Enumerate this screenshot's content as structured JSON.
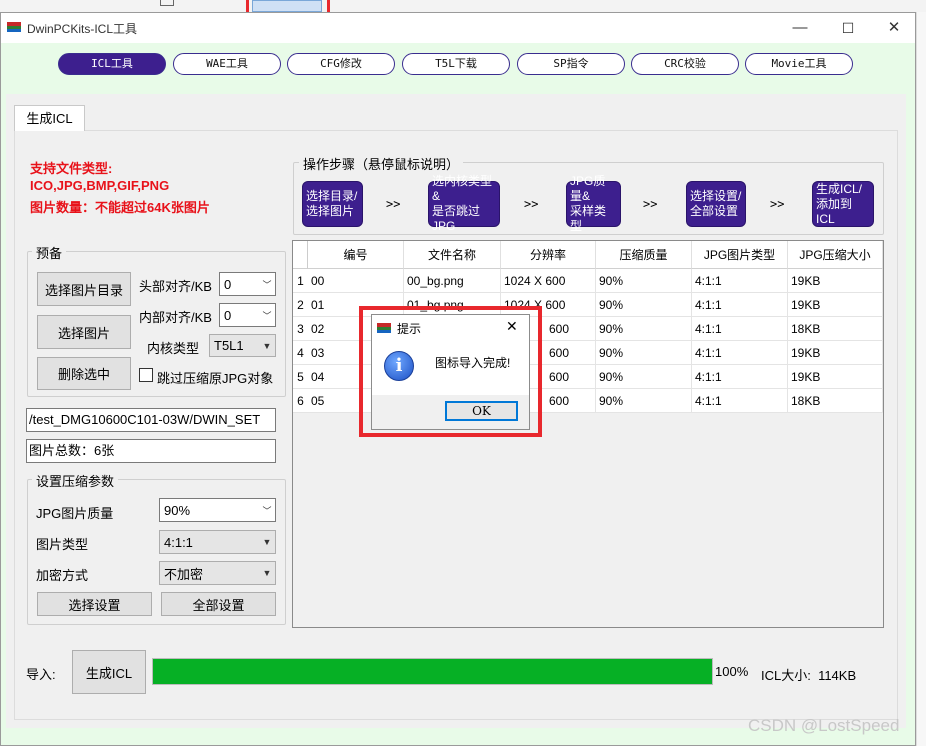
{
  "window": {
    "title": "DwinPCKits-ICL工具",
    "min_glyph": "—",
    "max_glyph": "☐",
    "close_glyph": "✕"
  },
  "top_tabs": [
    "ICL工具",
    "WAE工具",
    "CFG修改",
    "T5L下载",
    "SP指令",
    "CRC校验",
    "Movie工具"
  ],
  "subtab": "生成ICL",
  "supported": {
    "line1": "支持文件类型:",
    "line2": "ICO,JPG,BMP,GIF,PNG",
    "line3": "图片数量：不能超过64K张图片"
  },
  "steps": {
    "title": "操作步骤（悬停鼠标说明）",
    "items": [
      [
        "选择目录/",
        "选择图片"
      ],
      [
        "选内核类型&",
        "是否跳过JPG"
      ],
      [
        "JPG质量&",
        "采样类型"
      ],
      [
        "选择设置/",
        "全部设置"
      ],
      [
        "生成ICL/",
        "添加到ICL"
      ]
    ],
    "sep": ">>"
  },
  "prep": {
    "title": "预备",
    "select_dir": "选择图片目录",
    "select_img": "选择图片",
    "delete_sel": "删除选中",
    "head_align_label": "头部对齐/KB",
    "head_align_value": "0",
    "inner_align_label": "内部对齐/KB",
    "inner_align_value": "0",
    "core_label": "内核类型",
    "core_value": "T5L1",
    "skip_jpg_label": "跳过压缩原JPG对象"
  },
  "path_value": "/test_DMG10600C101-03W/DWIN_SET",
  "total_value": "图片总数：6张",
  "compress": {
    "title": "设置压缩参数",
    "quality_label": "JPG图片质量",
    "quality_value": "90%",
    "type_label": "图片类型",
    "type_value": "4:1:1",
    "encrypt_label": "加密方式",
    "encrypt_value": "不加密",
    "select_set": "选择设置",
    "all_set": "全部设置"
  },
  "table": {
    "columns": [
      "编号",
      "文件名称",
      "分辨率",
      "压缩质量",
      "JPG图片类型",
      "JPG压缩大小"
    ],
    "rows": [
      [
        "1",
        "00",
        "00_bg.png",
        "1024 X 600",
        "90%",
        "4:1:1",
        "19KB"
      ],
      [
        "2",
        "01",
        "01_bg.png",
        "1024 X 600",
        "90%",
        "4:1:1",
        "19KB"
      ],
      [
        "3",
        "02",
        "",
        "600",
        "90%",
        "4:1:1",
        "18KB"
      ],
      [
        "4",
        "03",
        "",
        "600",
        "90%",
        "4:1:1",
        "19KB"
      ],
      [
        "5",
        "04",
        "",
        "600",
        "90%",
        "4:1:1",
        "19KB"
      ],
      [
        "6",
        "05",
        "",
        "600",
        "90%",
        "4:1:1",
        "18KB"
      ]
    ]
  },
  "bottom": {
    "import_label": "导入:",
    "generate": "生成ICL",
    "progress": 100,
    "percent_text": "100%",
    "size_text": "ICL大小:  114KB"
  },
  "dialog": {
    "title": "提示",
    "message": "图标导入完成!",
    "ok": "OK",
    "close_glyph": "✕",
    "info_glyph": "i"
  },
  "watermark": "CSDN @LostSpeed",
  "colors": {
    "accent_purple": "#3d1f8e",
    "progress_green": "#06b025",
    "warning_red": "#e8121a",
    "highlight_red": "#e8282d",
    "window_bg": "#e8fbe8"
  }
}
